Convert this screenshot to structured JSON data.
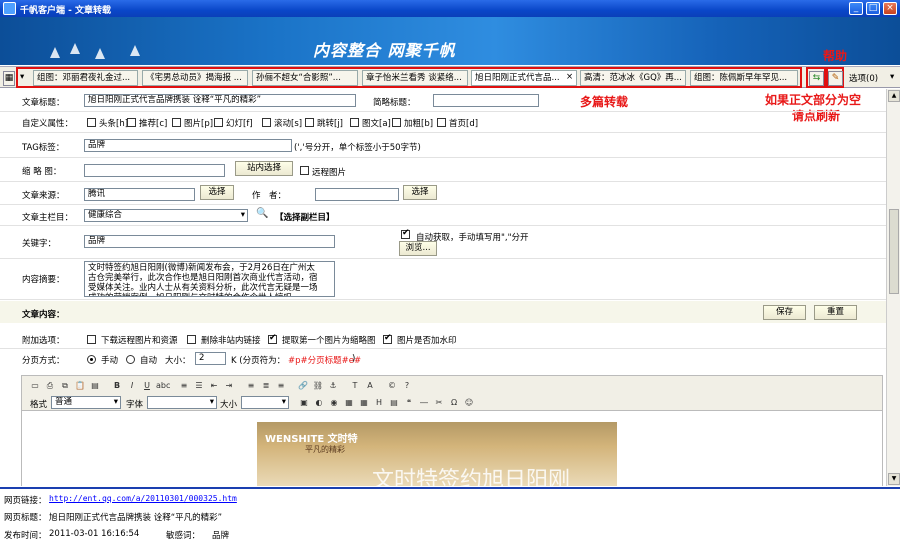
{
  "window": {
    "title": "千帆客户端 - 文章转载",
    "min": "_",
    "max": "□",
    "close": "×"
  },
  "banner": {
    "slogan": "内容整合 网聚千帆"
  },
  "tabs": [
    "组图：邓丽君夜礼金过...",
    "《宅男总动员》揭海报 ...",
    "孙俪不超女“合影照”...",
    "章子怡米兰看秀 谈紧络...",
    "旭日阳刚正式代言品...",
    "高清：范冰冰《GQ》再...",
    "组图：陈佩斯早年罕见..."
  ],
  "tab_close": "×",
  "toolbar": {
    "options_label": "选项(0)",
    "dropdown": "▾"
  },
  "annotations": {
    "help": "帮助",
    "multi": "多篇转载",
    "refresh_line1": "如果正文部分为空",
    "refresh_line2": "请点刷新"
  },
  "form": {
    "title_label": "文章标题：",
    "title_value": "旭日阳刚正式代言品牌携装 诠释“平凡的精彩”",
    "short_title_label": "简略标题：",
    "short_title_value": "",
    "attr_label": "自定义属性：",
    "attrs": [
      {
        "label": "头条[h]",
        "on": false
      },
      {
        "label": "推荐[c]",
        "on": false
      },
      {
        "label": "图片[p]",
        "on": false
      },
      {
        "label": "幻灯[f]",
        "on": false
      },
      {
        "label": "滚动[s]",
        "on": false
      },
      {
        "label": "跳转[j]",
        "on": false
      },
      {
        "label": "图文[a]",
        "on": false
      },
      {
        "label": "加粗[b]",
        "on": false
      },
      {
        "label": "首页[d]",
        "on": false
      }
    ],
    "tag_label": "TAG标签：",
    "tag_value": "品牌",
    "tag_hint": "(','号分开，单个标签小于50字节)",
    "thumb_label": "缩 略 图：",
    "thumb_value": "",
    "site_select_btn": "站内选择",
    "remote_img_label": "远程图片",
    "source_label": "文章来源：",
    "source_value": "腾讯",
    "select_btn": "选择",
    "author_label": "作　者：",
    "author_value": "",
    "select_btn2": "选择",
    "column_label": "文章主栏目：",
    "column_value": "健康综合",
    "sub_column": "【选择副栏目】",
    "keyword_label": "关键字：",
    "keyword_value": "品牌",
    "auto_get_label": "自动获取，手动填写用\",\"分开",
    "browse_btn": "浏览...",
    "summary_label": "内容摘要：",
    "summary_value": "文时特签约旭日阳刚(微博)新闻发布会，于2月26日在广州太古仓完美举行，此次合作也是旭日阳刚首次商业代言活动，宿受媒体关注。业内人士从有关资料分析，此次代言无疑是一场成功的营销案例，旭日阳刚与文时特的合作令世人惊叹。",
    "content_label": "文章内容：",
    "save_btn": "保存",
    "reset_btn": "重置",
    "extra_label": "附加选项：",
    "extras": [
      {
        "label": "下载远程图片和资源",
        "on": false
      },
      {
        "label": "删除非站内链接",
        "on": false
      },
      {
        "label": "提取第一个图片为缩略图",
        "on": true
      },
      {
        "label": "图片是否加水印",
        "on": true
      }
    ],
    "page_label": "分页方式：",
    "manual_label": "手动",
    "auto_label": "自动",
    "size_label": "大小：",
    "size_value": "2",
    "size_unit": "K (分页符为：",
    "page_marker": "#p#分页标题#e#",
    "page_end": ")",
    "format_label": "格式",
    "format_value": "普通",
    "font_label": "字体",
    "font_value": "",
    "fsize_label": "大小",
    "fsize_value": "",
    "photo_brand": "WENSHITE 文时特",
    "photo_sub": "平凡的精彩",
    "photo_text": "文时特签约旭日阳刚"
  },
  "status": {
    "url_label": "网页链接：",
    "url_value": "http://ent.qq.com/a/20110301/000325.htm",
    "title_label": "网页标题：",
    "title_value": "旭日阳刚正式代言品牌携装 诠释“平凡的精彩”",
    "time_label": "发布时间：",
    "time_value": "2011-03-01 16:16:54",
    "sens_label": "敏感词：",
    "sens_value": "品牌"
  }
}
